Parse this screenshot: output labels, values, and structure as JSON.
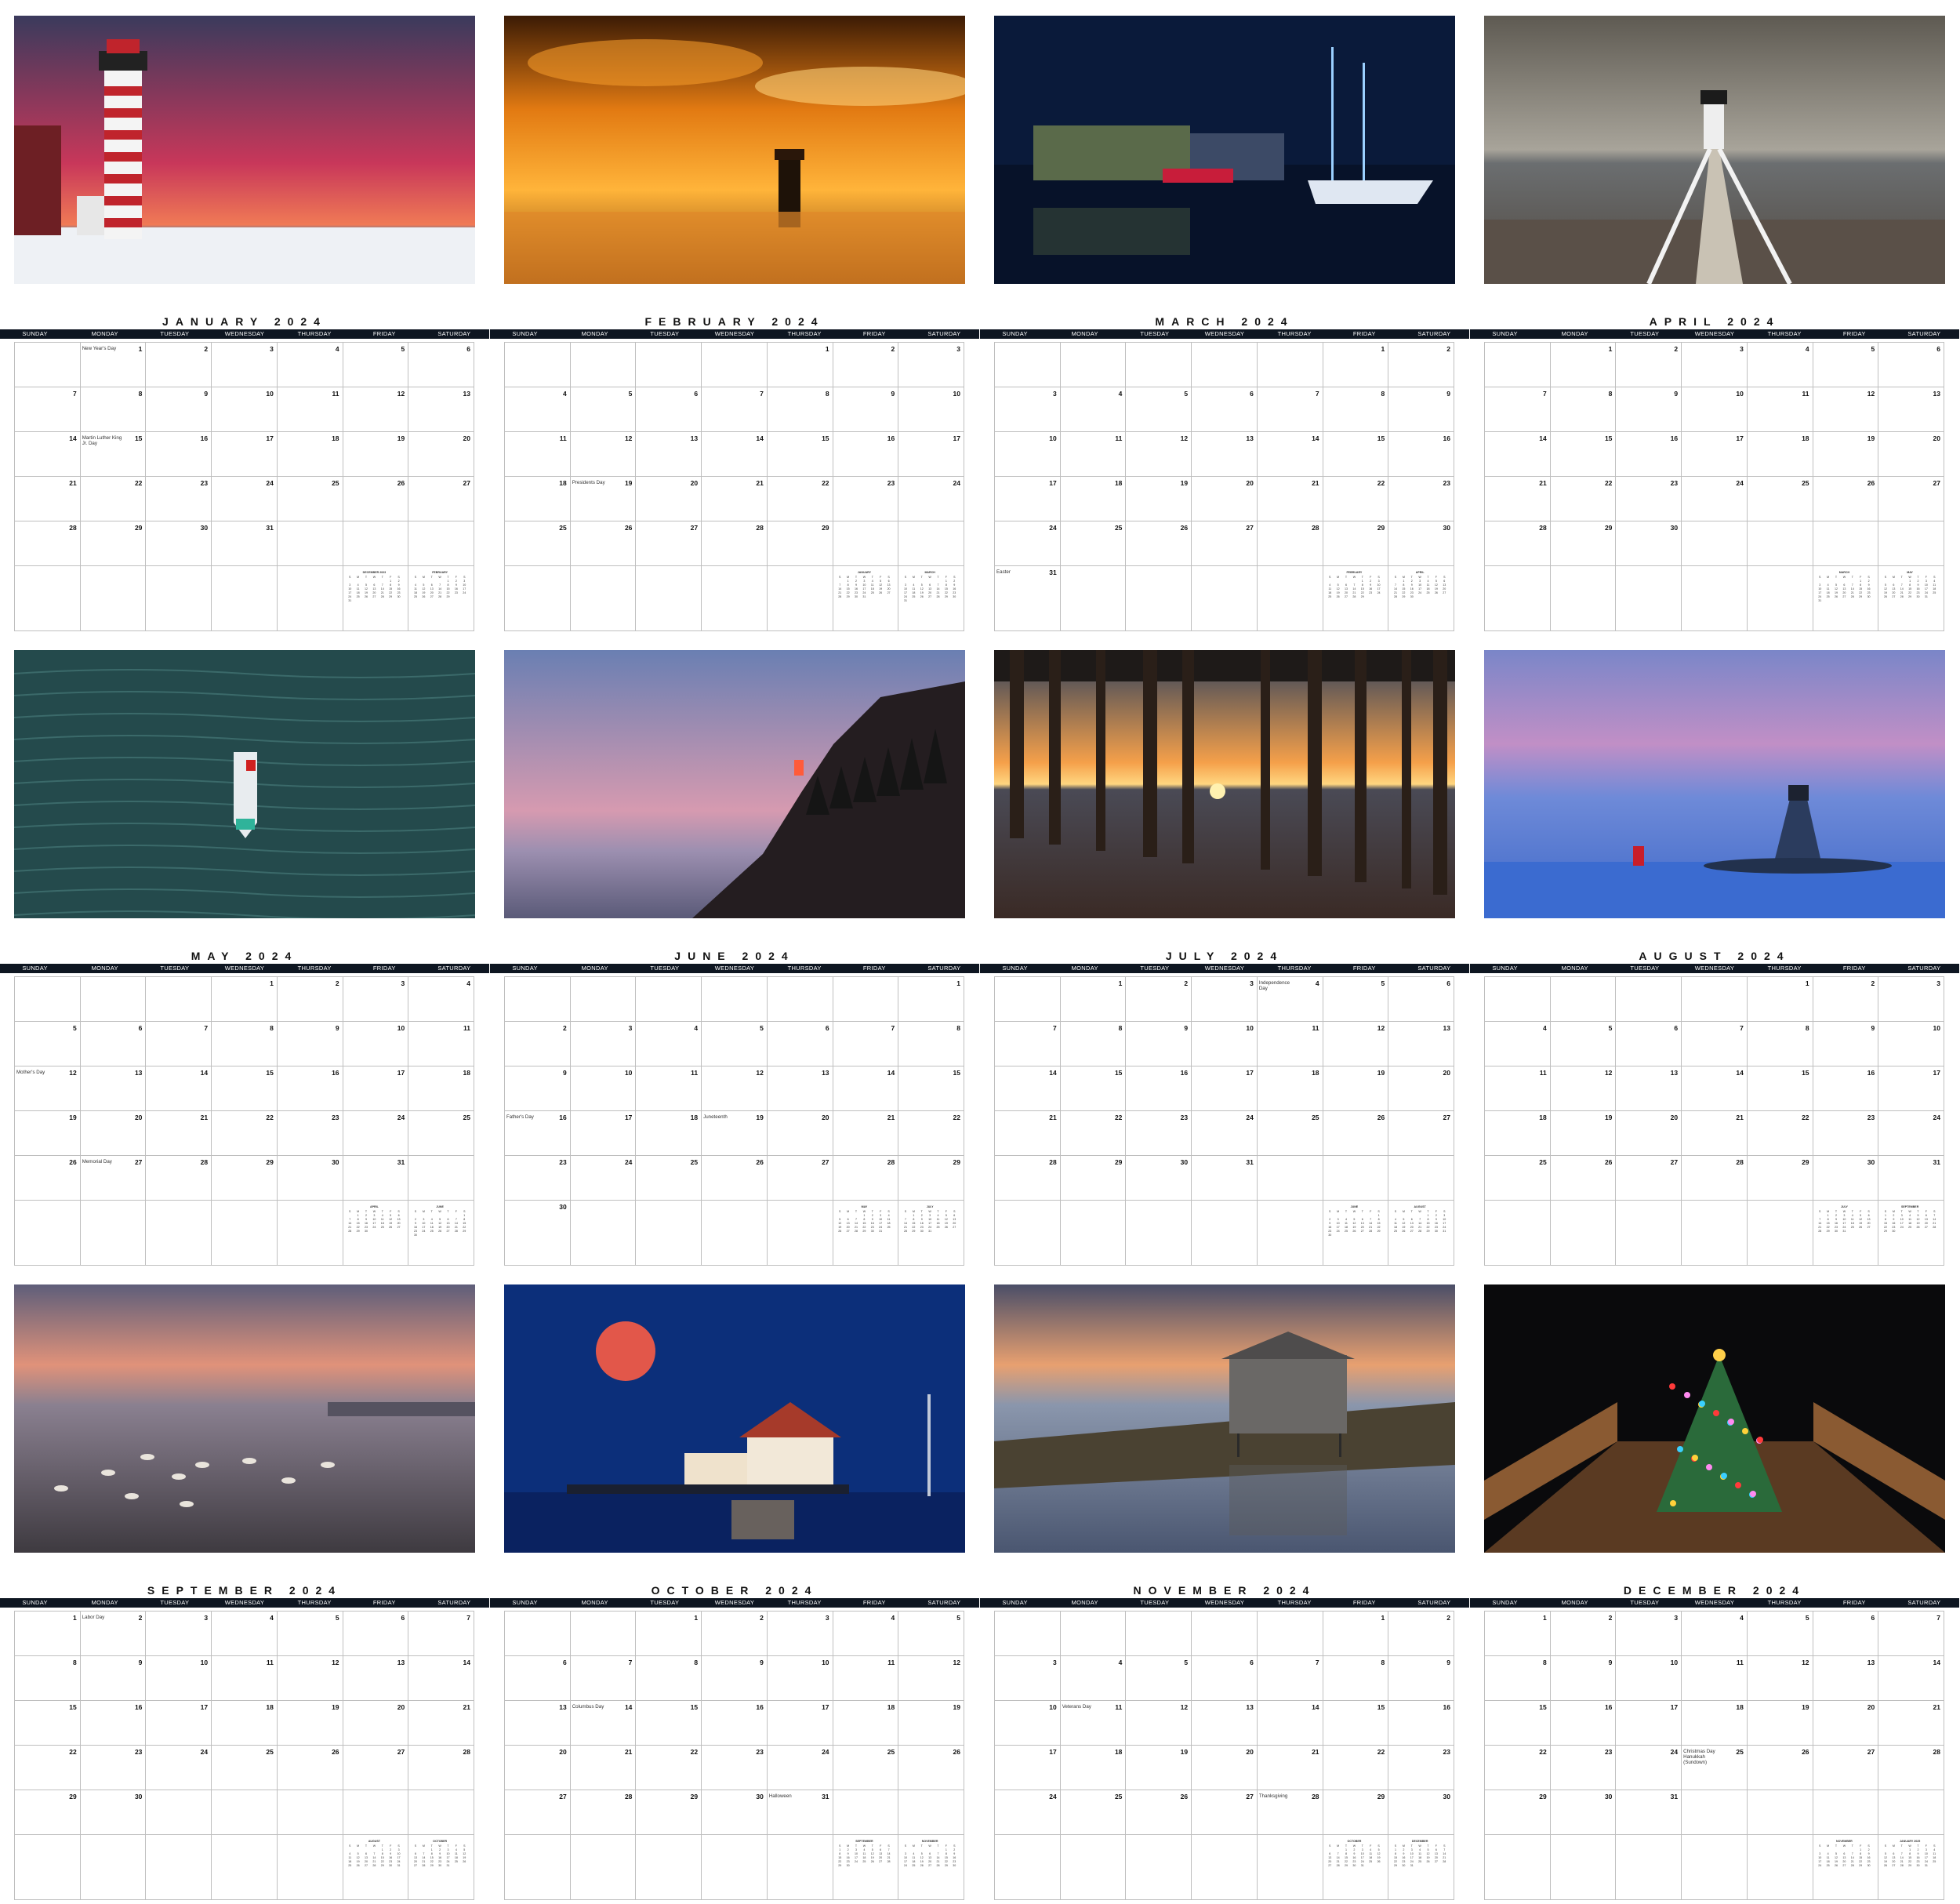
{
  "weekdays": [
    "SUNDAY",
    "MONDAY",
    "TUESDAY",
    "WEDNESDAY",
    "THURSDAY",
    "FRIDAY",
    "SATURDAY"
  ],
  "mini_weekdays": [
    "S",
    "M",
    "T",
    "W",
    "T",
    "F",
    "S"
  ],
  "year": 2024,
  "months": [
    {
      "title": "JANUARY 2024",
      "photo": "red-white-striped-lighthouse-at-sunrise",
      "start": 1,
      "days": 31,
      "holidays": {
        "1": "New Year's Day",
        "15": "Martin Luther King Jr. Day"
      },
      "minis": [
        {
          "name": "DECEMBER 2023",
          "start": 5,
          "days": 31
        },
        {
          "name": "FEBRUARY",
          "start": 4,
          "days": 29
        }
      ]
    },
    {
      "title": "FEBRUARY 2024",
      "photo": "lighthouse-in-golden-sea-smoke",
      "start": 4,
      "days": 29,
      "holidays": {
        "19": "Presidents Day"
      },
      "minis": [
        {
          "name": "JANUARY",
          "start": 1,
          "days": 31
        },
        {
          "name": "MARCH",
          "start": 5,
          "days": 31
        }
      ]
    },
    {
      "title": "MARCH 2024",
      "photo": "harbor-at-night-with-tall-ship",
      "start": 5,
      "days": 31,
      "holidays": {
        "31": "Easter"
      },
      "minis": [
        {
          "name": "FEBRUARY",
          "start": 4,
          "days": 29
        },
        {
          "name": "APRIL",
          "start": 1,
          "days": 30
        }
      ]
    },
    {
      "title": "APRIL 2024",
      "photo": "wooden-walkway-to-lighthouse",
      "start": 1,
      "days": 30,
      "holidays": {},
      "minis": [
        {
          "name": "MARCH",
          "start": 5,
          "days": 31
        },
        {
          "name": "MAY",
          "start": 3,
          "days": 31
        }
      ]
    },
    {
      "title": "MAY 2024",
      "photo": "aerial-fishing-boat-on-water",
      "start": 3,
      "days": 31,
      "holidays": {
        "12": "Mother's Day",
        "27": "Memorial Day"
      },
      "minis": [
        {
          "name": "APRIL",
          "start": 1,
          "days": 30
        },
        {
          "name": "JUNE",
          "start": 6,
          "days": 30
        }
      ]
    },
    {
      "title": "JUNE 2024",
      "photo": "lighthouse-on-rocky-cliff-at-dusk",
      "start": 6,
      "days": 30,
      "holidays": {
        "16": "Father's Day",
        "19": "Juneteenth"
      },
      "minis": [
        {
          "name": "MAY",
          "start": 3,
          "days": 31
        },
        {
          "name": "JULY",
          "start": 1,
          "days": 31
        }
      ]
    },
    {
      "title": "JULY 2024",
      "photo": "sunrise-under-pier",
      "start": 1,
      "days": 31,
      "holidays": {
        "4": "Independence Day"
      },
      "minis": [
        {
          "name": "JUNE",
          "start": 6,
          "days": 30
        },
        {
          "name": "AUGUST",
          "start": 4,
          "days": 31
        }
      ]
    },
    {
      "title": "AUGUST 2024",
      "photo": "lighthouse-on-ledge-at-twilight",
      "start": 4,
      "days": 31,
      "holidays": {},
      "minis": [
        {
          "name": "JULY",
          "start": 1,
          "days": 31
        },
        {
          "name": "SEPTEMBER",
          "start": 0,
          "days": 30
        }
      ]
    },
    {
      "title": "SEPTEMBER 2024",
      "photo": "harbor-boats-at-dawn",
      "start": 0,
      "days": 30,
      "holidays": {
        "2": "Labor Day"
      },
      "minis": [
        {
          "name": "AUGUST",
          "start": 4,
          "days": 31
        },
        {
          "name": "OCTOBER",
          "start": 2,
          "days": 31
        }
      ]
    },
    {
      "title": "OCTOBER 2024",
      "photo": "full-moon-over-lighthouse-station",
      "start": 2,
      "days": 31,
      "holidays": {
        "14": "Columbus Day",
        "31": "Halloween"
      },
      "minis": [
        {
          "name": "SEPTEMBER",
          "start": 0,
          "days": 30
        },
        {
          "name": "NOVEMBER",
          "start": 5,
          "days": 30
        }
      ]
    },
    {
      "title": "NOVEMBER 2024",
      "photo": "fishing-shack-on-stilts",
      "start": 5,
      "days": 30,
      "holidays": {
        "11": "Veterans Day",
        "28": "Thanksgiving"
      },
      "minis": [
        {
          "name": "OCTOBER",
          "start": 2,
          "days": 31
        },
        {
          "name": "DECEMBER",
          "start": 0,
          "days": 31
        }
      ]
    },
    {
      "title": "DECEMBER 2024",
      "photo": "lobster-trap-christmas-tree",
      "start": 0,
      "days": 31,
      "holidays": {
        "25": "Christmas Day Hanukkah (Sundown)"
      },
      "minis": [
        {
          "name": "NOVEMBER",
          "start": 5,
          "days": 30
        },
        {
          "name": "JANUARY 2025",
          "start": 3,
          "days": 31
        }
      ]
    }
  ]
}
